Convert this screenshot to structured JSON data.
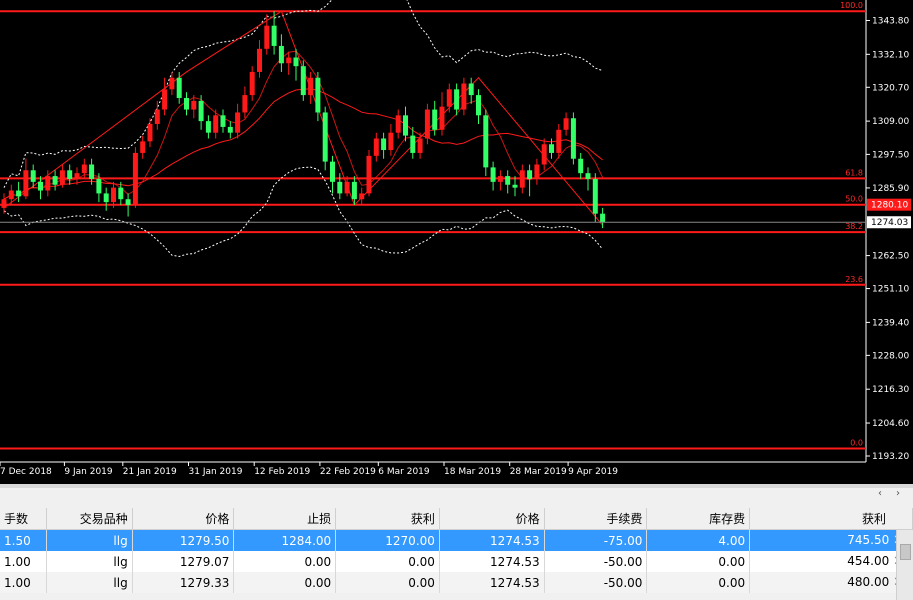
{
  "chart": {
    "price_axis": [
      "1343.80",
      "1332.10",
      "1320.70",
      "1309.00",
      "1297.50",
      "1285.90",
      "1274.03",
      "1262.50",
      "1251.10",
      "1239.40",
      "1228.00",
      "1216.30",
      "1204.60",
      "1193.20"
    ],
    "price_tag_red": "1280.10",
    "price_tag_current": "1274.03",
    "dates": [
      "7 Dec 2018",
      "9 Jan 2019",
      "21 Jan 2019",
      "31 Jan 2019",
      "12 Feb 2019",
      "22 Feb 2019",
      "6 Mar 2019",
      "18 Mar 2019",
      "28 Mar 2019",
      "9 Apr 2019"
    ],
    "fib_levels": [
      {
        "label": "100.0"
      },
      {
        "label": "61.8"
      },
      {
        "label": "50.0"
      },
      {
        "label": "38.2"
      },
      {
        "label": "23.6"
      },
      {
        "label": "0.0"
      }
    ],
    "colors": {
      "background": "#000000",
      "bull": "#ff1a1a",
      "bear": "#33ff66",
      "fib": "#ff1a1a",
      "band": "#ffffff"
    }
  },
  "chart_data": {
    "type": "candlestick",
    "title": "",
    "xlabel": "",
    "ylabel": "",
    "ylim": [
      1193.2,
      1349.5
    ],
    "x_ticks": [
      "7 Dec 2018",
      "9 Jan 2019",
      "21 Jan 2019",
      "31 Jan 2019",
      "12 Feb 2019",
      "22 Feb 2019",
      "6 Mar 2019",
      "18 Mar 2019",
      "28 Mar 2019",
      "9 Apr 2019"
    ],
    "y_ticks": [
      1343.8,
      1332.1,
      1320.7,
      1309.0,
      1297.5,
      1285.9,
      1274.03,
      1262.5,
      1251.1,
      1239.4,
      1228.0,
      1216.3,
      1204.6,
      1193.2
    ],
    "fibonacci": [
      {
        "label": "100.0",
        "value": 1347.0
      },
      {
        "label": "61.8",
        "value": 1289.2
      },
      {
        "label": "50.0",
        "value": 1280.1
      },
      {
        "label": "38.2",
        "value": 1270.6
      },
      {
        "label": "23.6",
        "value": 1252.4
      },
      {
        "label": "0.0",
        "value": 1195.8
      }
    ],
    "candles": [
      [
        1279,
        1282,
        1277,
        1284
      ],
      [
        1282,
        1285,
        1280,
        1287
      ],
      [
        1285,
        1283,
        1281,
        1288
      ],
      [
        1283,
        1292,
        1282,
        1296
      ],
      [
        1292,
        1288,
        1286,
        1294
      ],
      [
        1288,
        1285,
        1282,
        1290
      ],
      [
        1285,
        1290,
        1283,
        1292
      ],
      [
        1290,
        1287,
        1285,
        1292
      ],
      [
        1287,
        1292,
        1286,
        1294
      ],
      [
        1292,
        1289,
        1287,
        1294
      ],
      [
        1289,
        1291,
        1287,
        1293
      ],
      [
        1291,
        1294,
        1289,
        1296
      ],
      [
        1294,
        1289,
        1287,
        1296
      ],
      [
        1289,
        1284,
        1281,
        1291
      ],
      [
        1284,
        1281,
        1278,
        1286
      ],
      [
        1281,
        1286,
        1279,
        1288
      ],
      [
        1286,
        1282,
        1280,
        1288
      ],
      [
        1282,
        1280,
        1276,
        1284
      ],
      [
        1280,
        1298,
        1279,
        1300
      ],
      [
        1298,
        1302,
        1296,
        1304
      ],
      [
        1302,
        1308,
        1300,
        1310
      ],
      [
        1308,
        1313,
        1306,
        1316
      ],
      [
        1313,
        1320,
        1311,
        1324
      ],
      [
        1320,
        1324,
        1318,
        1326
      ],
      [
        1324,
        1317,
        1315,
        1326
      ],
      [
        1317,
        1313,
        1311,
        1319
      ],
      [
        1313,
        1316,
        1310,
        1318
      ],
      [
        1316,
        1309,
        1306,
        1318
      ],
      [
        1309,
        1305,
        1303,
        1311
      ],
      [
        1305,
        1311,
        1303,
        1313
      ],
      [
        1311,
        1307,
        1305,
        1313
      ],
      [
        1307,
        1305,
        1303,
        1309
      ],
      [
        1305,
        1312,
        1303,
        1315
      ],
      [
        1312,
        1318,
        1310,
        1321
      ],
      [
        1318,
        1326,
        1316,
        1328
      ],
      [
        1326,
        1334,
        1324,
        1337
      ],
      [
        1334,
        1342,
        1332,
        1346
      ],
      [
        1342,
        1335,
        1332,
        1347
      ],
      [
        1335,
        1329,
        1326,
        1339
      ],
      [
        1329,
        1331,
        1325,
        1333
      ],
      [
        1331,
        1328,
        1323,
        1334
      ],
      [
        1328,
        1318,
        1316,
        1330
      ],
      [
        1318,
        1324,
        1315,
        1326
      ],
      [
        1324,
        1312,
        1309,
        1326
      ],
      [
        1312,
        1295,
        1292,
        1314
      ],
      [
        1295,
        1288,
        1284,
        1297
      ],
      [
        1288,
        1284,
        1282,
        1291
      ],
      [
        1284,
        1288,
        1283,
        1290
      ],
      [
        1288,
        1282,
        1280,
        1290
      ],
      [
        1282,
        1284,
        1280,
        1286
      ],
      [
        1284,
        1297,
        1283,
        1299
      ],
      [
        1297,
        1303,
        1295,
        1305
      ],
      [
        1303,
        1299,
        1296,
        1305
      ],
      [
        1299,
        1305,
        1297,
        1308
      ],
      [
        1305,
        1311,
        1303,
        1313
      ],
      [
        1311,
        1304,
        1302,
        1314
      ],
      [
        1304,
        1298,
        1296,
        1307
      ],
      [
        1298,
        1303,
        1296,
        1305
      ],
      [
        1303,
        1313,
        1301,
        1315
      ],
      [
        1313,
        1306,
        1304,
        1316
      ],
      [
        1306,
        1314,
        1304,
        1319
      ],
      [
        1314,
        1320,
        1312,
        1322
      ],
      [
        1320,
        1313,
        1311,
        1322
      ],
      [
        1313,
        1322,
        1311,
        1324
      ],
      [
        1322,
        1318,
        1315,
        1324
      ],
      [
        1318,
        1311,
        1308,
        1320
      ],
      [
        1311,
        1293,
        1290,
        1313
      ],
      [
        1293,
        1288,
        1285,
        1295
      ],
      [
        1288,
        1290,
        1285,
        1292
      ],
      [
        1290,
        1287,
        1284,
        1292
      ],
      [
        1287,
        1286,
        1283,
        1290
      ],
      [
        1286,
        1292,
        1284,
        1294
      ],
      [
        1292,
        1289,
        1283,
        1294
      ],
      [
        1289,
        1294,
        1287,
        1296
      ],
      [
        1294,
        1301,
        1292,
        1303
      ],
      [
        1301,
        1298,
        1296,
        1303
      ],
      [
        1298,
        1306,
        1296,
        1308
      ],
      [
        1306,
        1310,
        1304,
        1312
      ],
      [
        1310,
        1296,
        1294,
        1312
      ],
      [
        1296,
        1291,
        1289,
        1298
      ],
      [
        1291,
        1289,
        1285,
        1293
      ],
      [
        1289,
        1277,
        1274,
        1291
      ],
      [
        1277,
        1274,
        1272,
        1279
      ]
    ]
  },
  "tabbar": {
    "left_arrow": "‹",
    "right_arrow": "›"
  },
  "table": {
    "headers": [
      "手数",
      "交易品种",
      "价格",
      "止损",
      "获利",
      "价格",
      "手续费",
      "库存费",
      "获利"
    ],
    "rows": [
      [
        "1.50",
        "llg",
        "1279.50",
        "1284.00",
        "1270.00",
        "1274.53",
        "-75.00",
        "4.00",
        "745.50"
      ],
      [
        "1.00",
        "llg",
        "1279.07",
        "0.00",
        "0.00",
        "1274.53",
        "-50.00",
        "0.00",
        "454.00"
      ],
      [
        "1.00",
        "llg",
        "1279.33",
        "0.00",
        "0.00",
        "1274.53",
        "-50.00",
        "0.00",
        "480.00"
      ]
    ],
    "close_glyph": "✕"
  }
}
